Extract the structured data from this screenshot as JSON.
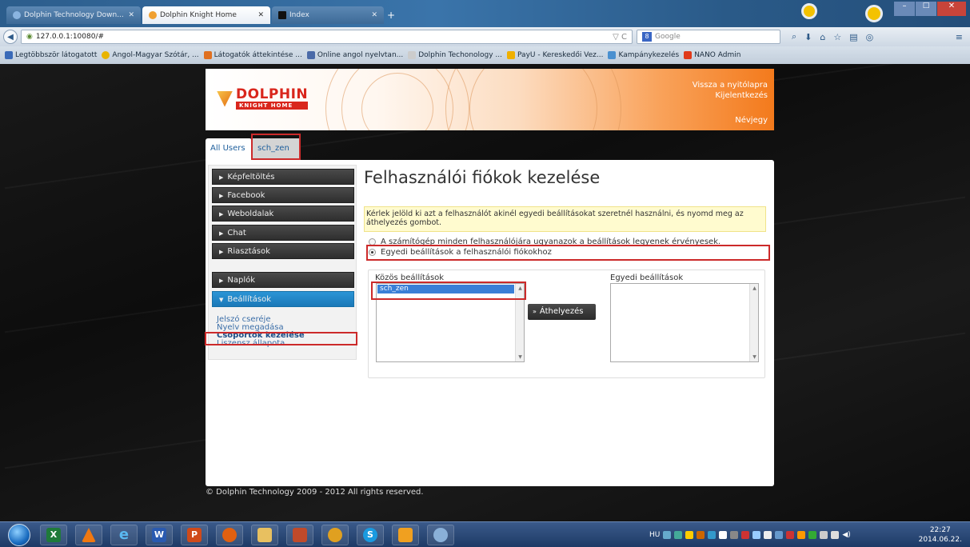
{
  "browser": {
    "tabs": [
      {
        "label": "Dolphin Technology Down...",
        "active": false
      },
      {
        "label": "Dolphin Knight Home",
        "active": true
      },
      {
        "label": "Index",
        "active": false
      }
    ],
    "new_tab": "+",
    "url": "127.0.0.1:10080/#",
    "search_placeholder": "Google",
    "bookmarks": [
      "Legtöbbször látogatott",
      "Angol-Magyar Szótár, ...",
      "Látogatók áttekintése ...",
      "Online angol nyelvtan...",
      "Dolphin Techonology ...",
      "PayU - Kereskedői Vez...",
      "Kampánykezelés",
      "NANO Admin"
    ]
  },
  "header": {
    "logo_main": "DOLPHIN",
    "logo_sub": "KNIGHT HOME",
    "link_home": "Vissza a nyitólapra",
    "link_logout": "Kijelentkezés",
    "link_about": "Névjegy"
  },
  "user_tabs": {
    "all": "All Users",
    "current": "sch_zen"
  },
  "sidebar": {
    "items": [
      "Képfeltöltés",
      "Facebook",
      "Weboldalak",
      "Chat",
      "Riasztások"
    ],
    "logs": "Naplók",
    "settings": "Beállítások",
    "sublinks": [
      "Jelszó cseréje",
      "Nyelv megadása",
      "Csoportok kezelése",
      "Liszensz állapota"
    ]
  },
  "main": {
    "title": "Felhasználói fiókok kezelése",
    "notice": "Kérlek jelöld ki azt a felhasználót akinél egyedi beállításokat szeretnél használni, és nyomd meg az áthelyezés gombot.",
    "option_same": "A számítógép minden felhasználójára ugyanazok a beállítások legyenek érvényesek.",
    "option_individual": "Egyedi beállítások a felhasználói fiókokhoz",
    "shared_label": "Közös beállítások",
    "individual_label": "Egyedi beállítások",
    "shared_users": [
      "sch_zen"
    ],
    "move_button": "Áthelyezés",
    "move_glyph": "»"
  },
  "footer": "© Dolphin Technology 2009 - 2012 All rights reserved.",
  "taskbar": {
    "language": "HU",
    "time": "22:27",
    "date": "2014.06.22."
  }
}
